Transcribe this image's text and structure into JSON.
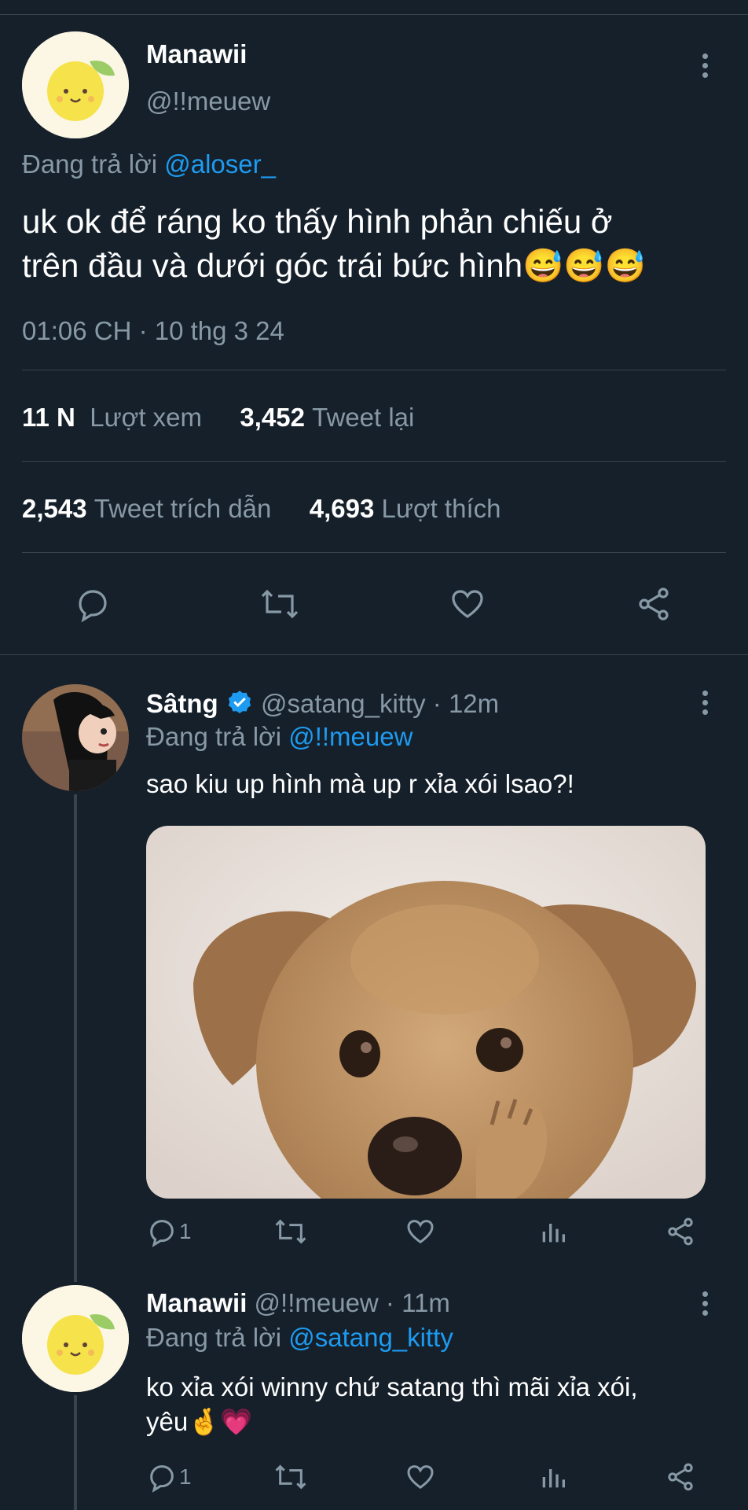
{
  "main_tweet": {
    "display_name": "Manawii",
    "handle": "@!!meuew",
    "reply_prefix": "Đang trả lời",
    "reply_to": "@aloser_",
    "text_line1": "uk ok để ráng ko thấy hình phản chiếu ở",
    "text_line2": "trên đầu và dưới góc trái bức hình",
    "emojis": "😅😅😅",
    "timestamp": "01:06 CH · 10 thg 3 24",
    "stats": {
      "views_count": "11 N",
      "views_label": "Lượt xem",
      "retweets_count": "3,452",
      "retweets_label": "Tweet lại",
      "quotes_count": "2,543",
      "quotes_label": "Tweet trích dẫn",
      "likes_count": "4,693",
      "likes_label": "Lượt thích"
    }
  },
  "replies": [
    {
      "display_name": "Sâtng",
      "handle_time": "@satang_kitty · 12m",
      "reply_prefix": "Đang trả lời",
      "reply_to": "@!!meuew",
      "text": "sao kiu up hình mà up r xỉa xói lsao?!",
      "reply_count": "1",
      "verified": true
    },
    {
      "display_name": "Manawii",
      "handle_time": "@!!meuew · 11m",
      "reply_prefix": "Đang trả lời",
      "reply_to": "@satang_kitty",
      "text_line1": "ko xỉa xói winny chứ satang thì mãi xỉa xói,",
      "text_line2": "yêu",
      "emojis": "🤞💗",
      "reply_count": "1"
    }
  ],
  "colors": {
    "background": "#15202b",
    "muted": "#8899a6",
    "link": "#1d9bf0",
    "divider": "#38444d"
  }
}
